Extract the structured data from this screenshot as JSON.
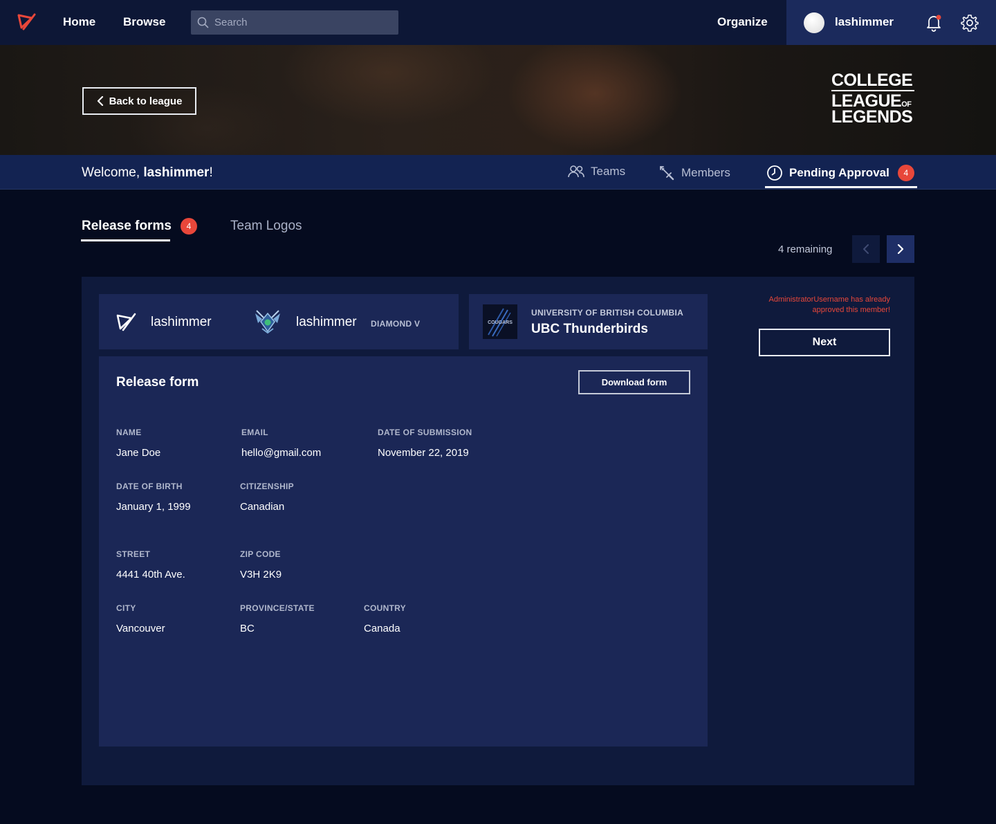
{
  "nav": {
    "home": "Home",
    "browse": "Browse",
    "search_placeholder": "Search",
    "organize": "Organize",
    "username": "lashimmer"
  },
  "banner": {
    "back_label": "Back to league",
    "league_logo": {
      "line1": "COLLEGE",
      "line2": "LEAGUE",
      "of": "OF",
      "line3": "LEGENDS"
    }
  },
  "subnav": {
    "welcome_prefix": "Welcome, ",
    "welcome_name": "lashimmer",
    "welcome_suffix": "!",
    "tabs": [
      {
        "label": "Teams",
        "icon": "users-icon"
      },
      {
        "label": "Members",
        "icon": "sword-icon"
      },
      {
        "label": "Pending Approval",
        "icon": "clock-icon",
        "badge": "4",
        "active": true
      }
    ]
  },
  "section_tabs": {
    "release_forms": "Release forms",
    "release_forms_badge": "4",
    "team_logos": "Team Logos"
  },
  "pagination": {
    "remaining": "4 remaining"
  },
  "player": {
    "summoner_name": "lashimmer",
    "game_name": "lashimmer",
    "rank": "DIAMOND V"
  },
  "team": {
    "school": "UNIVERSITY OF BRITISH COLUMBIA",
    "name": "UBC Thunderbirds",
    "logo_text": "COUGARS"
  },
  "release_form": {
    "title": "Release form",
    "download_label": "Download form",
    "fields": {
      "name": {
        "label": "NAME",
        "value": "Jane Doe"
      },
      "email": {
        "label": "EMAIL",
        "value": "hello@gmail.com"
      },
      "submission": {
        "label": "DATE OF SUBMISSION",
        "value": "November 22, 2019"
      },
      "dob": {
        "label": "DATE OF BIRTH",
        "value": "January 1, 1999"
      },
      "citizenship": {
        "label": "CITIZENSHIP",
        "value": "Canadian"
      },
      "street": {
        "label": "STREET",
        "value": "4441 40th Ave."
      },
      "zip": {
        "label": "ZIP CODE",
        "value": "V3H 2K9"
      },
      "city": {
        "label": "CITY",
        "value": "Vancouver"
      },
      "province": {
        "label": "PROVINCE/STATE",
        "value": "BC"
      },
      "country": {
        "label": "COUNTRY",
        "value": "Canada"
      }
    }
  },
  "approval": {
    "note": "AdministratorUsername has already approved this member!",
    "next_label": "Next"
  },
  "colors": {
    "nav_bg": "#0d1736",
    "user_block_bg": "#1b2a5c",
    "page_bg": "#050b1f",
    "card_bg": "#1b2756",
    "accent_red": "#e8473a"
  }
}
